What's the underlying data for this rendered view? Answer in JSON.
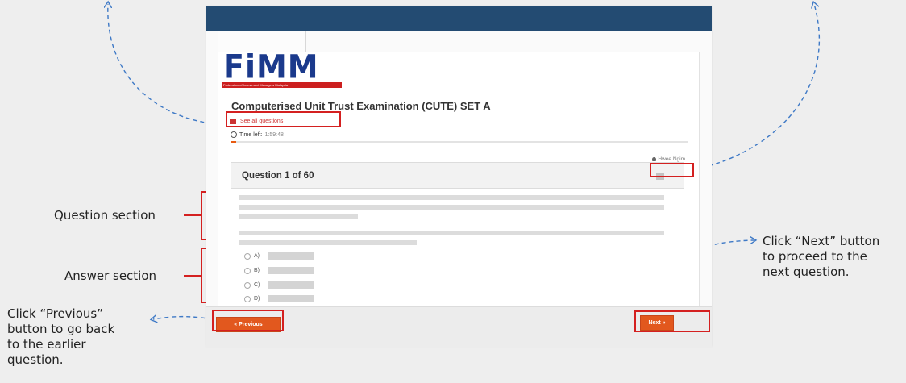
{
  "annotations": {
    "question_section": "Question section",
    "answer_section": "Answer section",
    "next_note": [
      "Click “Next” button",
      "to proceed to the",
      "next question."
    ],
    "previous_note": [
      "Click “Previous”",
      "button to go back",
      "to the earlier",
      "question."
    ]
  },
  "exam": {
    "logo_text": "FiMM",
    "logo_tagline": "Federation of Investment Managers Malaysia",
    "title": "Computerised Unit Trust Examination (CUTE) SET A",
    "see_all_label": "See all questions",
    "time_label": "Time left:",
    "time_value": "1:59:48",
    "progress": 0.01,
    "user_name": "Hwee Ngim",
    "question_counter": "Question 1 of 60",
    "options": [
      "A)",
      "B)",
      "C)",
      "D)"
    ],
    "previous_label": "« Previous",
    "next_label": "Next »"
  },
  "colors": {
    "topbar": "#234b72",
    "accent_button": "#e2581e",
    "highlight_box": "#d42020",
    "arrow": "#3e79c6"
  }
}
